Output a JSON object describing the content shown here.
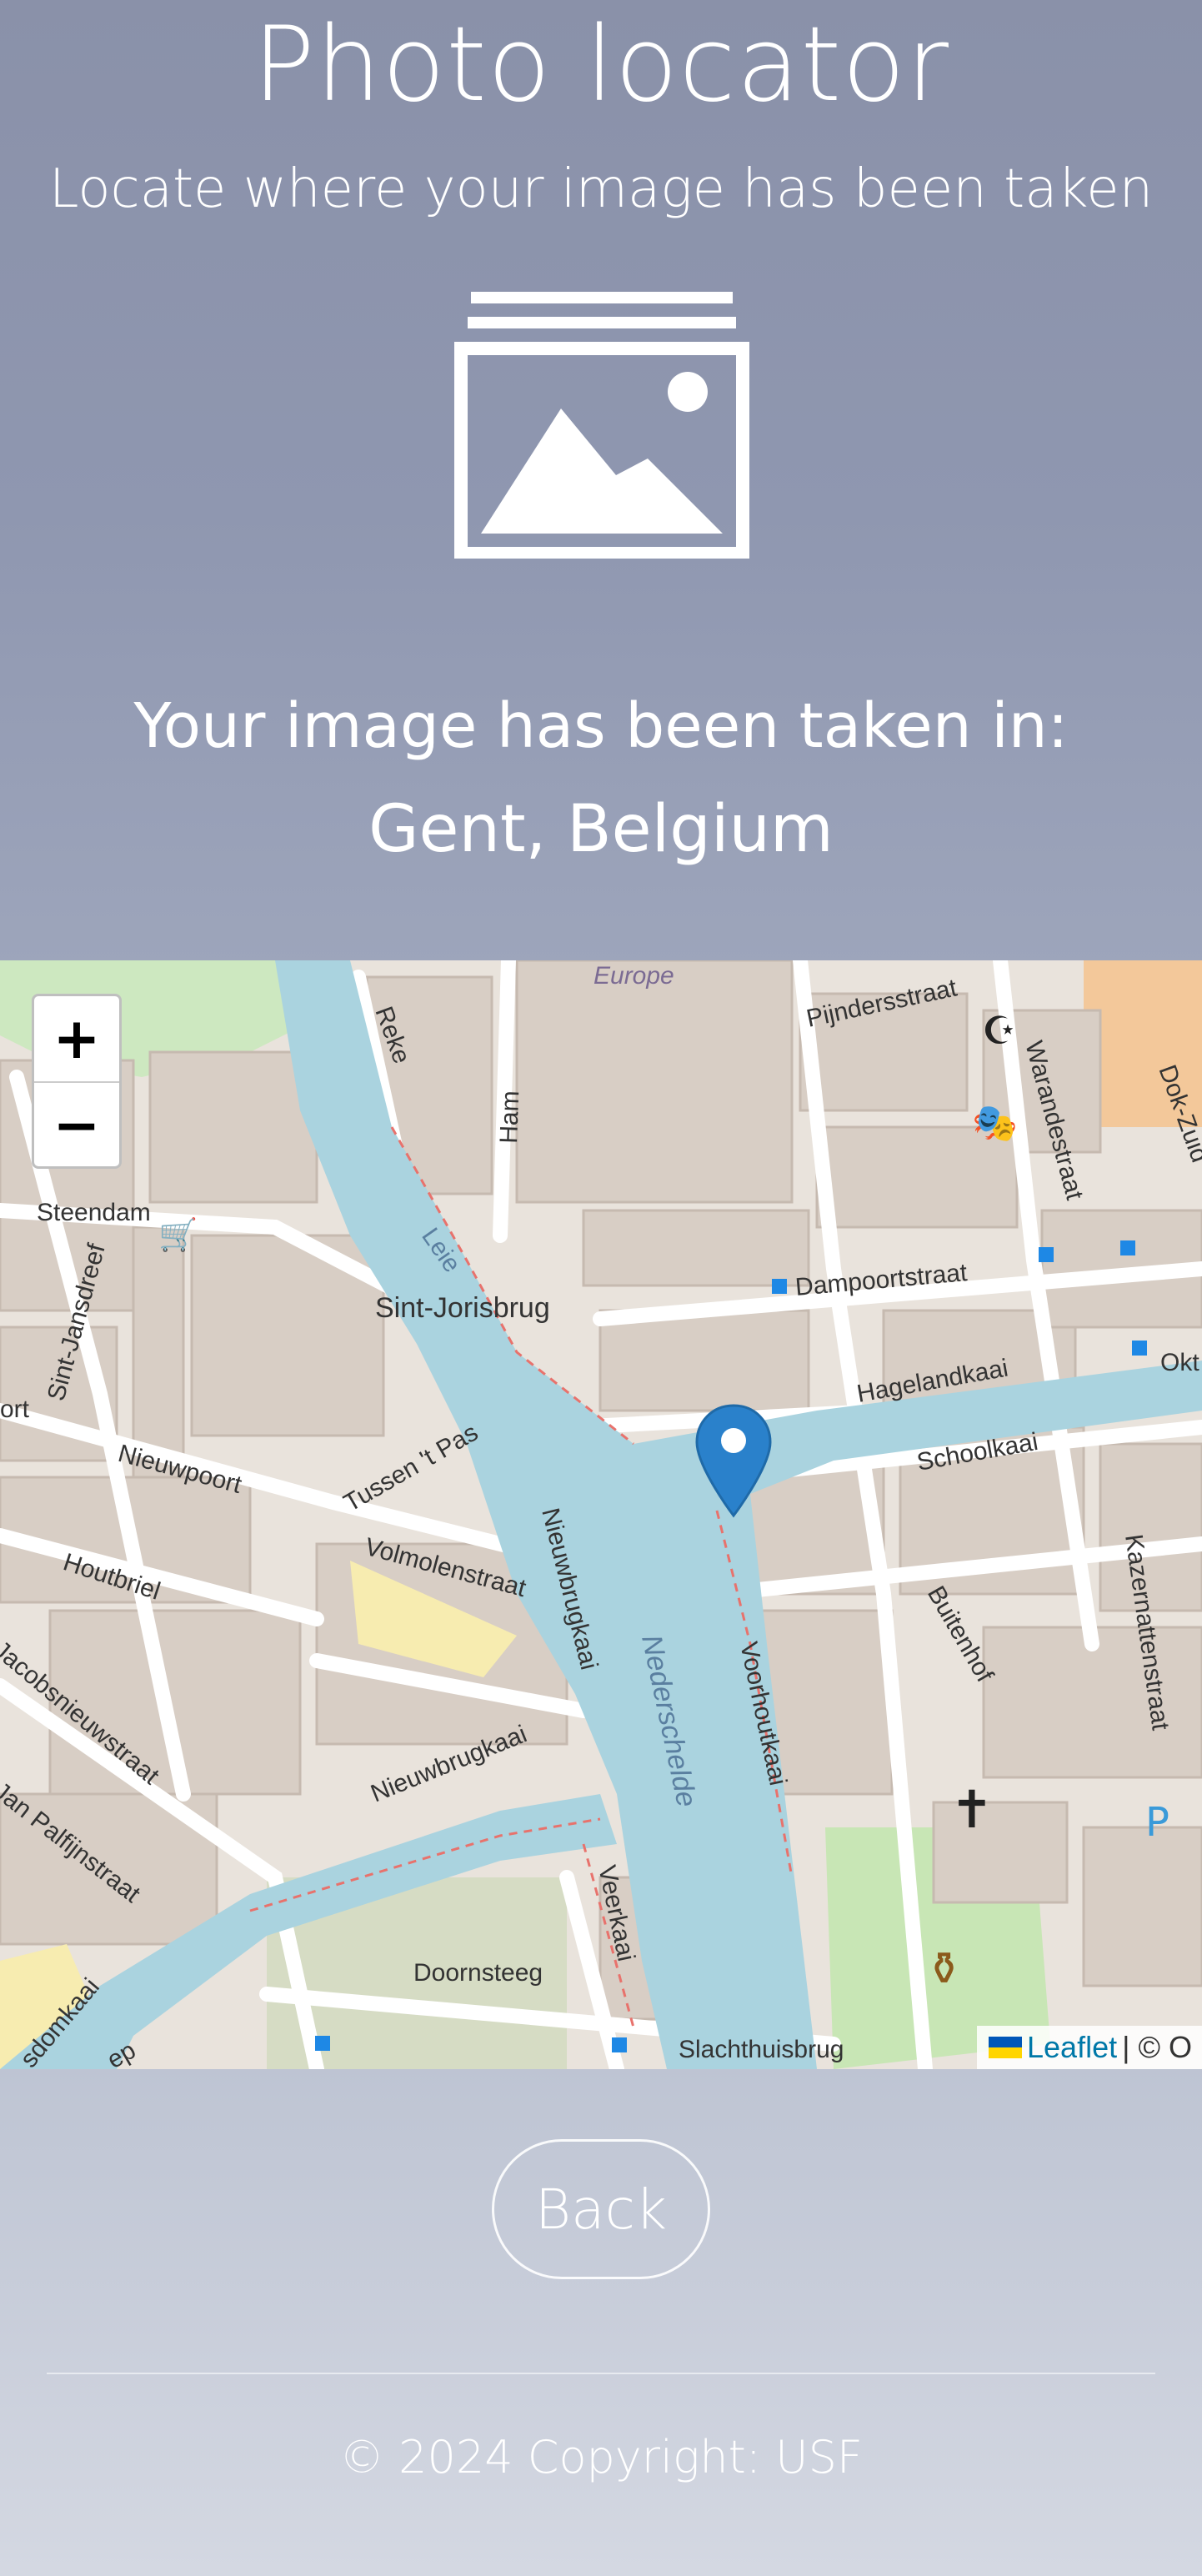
{
  "header": {
    "title": "Photo locator",
    "subtitle": "Locate where your image has been taken"
  },
  "result": {
    "label": "Your image has been taken in:",
    "location": "Gent, Belgium"
  },
  "map": {
    "zoom_in_label": "+",
    "zoom_out_label": "−",
    "attribution_link": "Leaflet",
    "attribution_rest": "| © O",
    "street_labels": {
      "europe": "Europe",
      "pijndersstraat": "Pijndersstraat",
      "warandestraat": "Warandestraat",
      "dok_zuid": "Dok-Zuid",
      "reke": "Reke",
      "ham": "Ham",
      "steendam": "Steendam",
      "leie": "Leie",
      "sint_jorisbrug": "Sint-Jorisbrug",
      "dampoortstraat": "Dampoortstraat",
      "sint_jansdreef": "Sint-Jansdreef",
      "hagelandkaai": "Hagelandkaai",
      "okt": "Okt",
      "ort": "ort",
      "nieuwpoort": "Nieuwpoort",
      "tussen_t_pas": "Tussen 't Pas",
      "schoolkaai": "Schoolkaai",
      "volmolenstraat": "Volmolenstraat",
      "houtbriel": "Houtbriel",
      "nieuwbrugkaai_1": "Nieuwbrugkaai",
      "nederschelde": "Nederschelde",
      "voorhoutkaai": "Voorhoutkaai",
      "buitenhof": "Buitenhof",
      "kazernattenstraat": "Kazernattenstraat",
      "jacobsnieuwstraat": "Jacobsnieuwstraat",
      "nieuwbrugkaai_2": "Nieuwbrugkaai",
      "jan_palfijnstraat": "Jan Palfijnstraat",
      "veerkaai": "Veerkaai",
      "doornsteeg": "Doornsteeg",
      "sdomkaai": "sdomkaai",
      "slachthuisbrug": "Slachthuisbrug",
      "ep": "ep",
      "parking": "P"
    }
  },
  "actions": {
    "back_label": "Back"
  },
  "footer": {
    "copyright": "© 2024 Copyright: USF"
  },
  "colors": {
    "water": "#aad3df",
    "building": "#d9cfc7",
    "park": "#c8e6b5",
    "marker": "#2a81cb"
  },
  "icons": [
    "image-stack-icon",
    "map-marker-icon",
    "ukraine-flag-icon"
  ]
}
